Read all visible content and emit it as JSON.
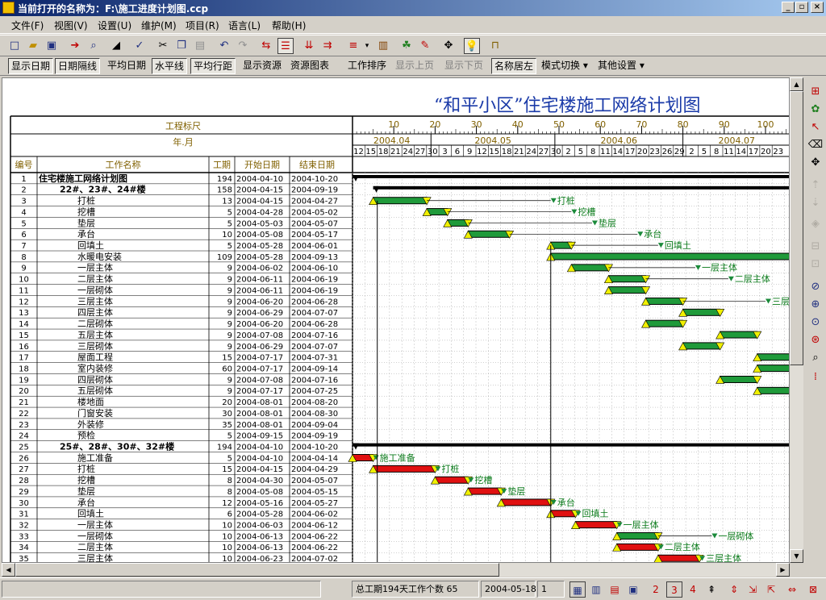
{
  "window": {
    "title": "当前打开的名称为：F:\\施工进度计划图.ccp",
    "min": "_",
    "max": "▫",
    "close": "×"
  },
  "menu": [
    "文件(F)",
    "视图(V)",
    "设置(U)",
    "维护(M)",
    "项目(R)",
    "语言(L)",
    "帮助(H)"
  ],
  "toolbar2": [
    {
      "label": "显示日期",
      "state": "pressed"
    },
    {
      "label": "日期隔线",
      "state": "pressed"
    },
    {
      "label": "平均日期",
      "state": "normal"
    },
    {
      "label": "水平线",
      "state": "pressed"
    },
    {
      "label": "平均行距",
      "state": "pressed"
    },
    {
      "label": "显示资源",
      "state": "normal"
    },
    {
      "label": "资源图表",
      "state": "normal"
    },
    {
      "label": "工作排序",
      "state": "normal"
    },
    {
      "label": "显示上页",
      "state": "disabled"
    },
    {
      "label": "显示下页",
      "state": "disabled"
    },
    {
      "label": "名称居左",
      "state": "pressed"
    },
    {
      "label": "模式切换 ▾",
      "state": "normal"
    },
    {
      "label": "其他设置 ▾",
      "state": "normal"
    }
  ],
  "chart_title": "“和平小区”住宅楼施工网络计划图",
  "header": {
    "ruler_label": "工程标尺",
    "month_label": "年.月",
    "col_id": "编号",
    "col_name": "工作名称",
    "col_dur": "工期",
    "col_start": "开始日期",
    "col_end": "结束日期"
  },
  "ruler_ticks": [
    "10",
    "20",
    "30",
    "40",
    "50",
    "60",
    "70",
    "80",
    "90",
    "100"
  ],
  "months": [
    "2004.04",
    "2004.05",
    "2004.06",
    "2004.07"
  ],
  "days": [
    "12",
    "15",
    "18",
    "21",
    "24",
    "27",
    "30",
    "3",
    "6",
    "9",
    "12",
    "15",
    "18",
    "21",
    "24",
    "27",
    "30",
    "2",
    "5",
    "8",
    "11",
    "14",
    "17",
    "20",
    "23",
    "26",
    "29",
    "2",
    "5",
    "8",
    "11",
    "14",
    "17",
    "20",
    "23"
  ],
  "rows": [
    {
      "id": "1",
      "name": "住宅楼施工网络计划图",
      "dur": "194",
      "start": "2004-04-10",
      "end": "2004-10-20",
      "lvl": 0
    },
    {
      "id": "2",
      "name": "22#、23#、24#楼",
      "dur": "158",
      "start": "2004-04-15",
      "end": "2004-09-19",
      "lvl": 1
    },
    {
      "id": "3",
      "name": "打桩",
      "dur": "13",
      "start": "2004-04-15",
      "end": "2004-04-27",
      "lvl": 2
    },
    {
      "id": "4",
      "name": "挖槽",
      "dur": "5",
      "start": "2004-04-28",
      "end": "2004-05-02",
      "lvl": 2
    },
    {
      "id": "5",
      "name": "垫层",
      "dur": "5",
      "start": "2004-05-03",
      "end": "2004-05-07",
      "lvl": 2
    },
    {
      "id": "6",
      "name": "承台",
      "dur": "10",
      "start": "2004-05-08",
      "end": "2004-05-17",
      "lvl": 2
    },
    {
      "id": "7",
      "name": "回填土",
      "dur": "5",
      "start": "2004-05-28",
      "end": "2004-06-01",
      "lvl": 2
    },
    {
      "id": "8",
      "name": "水暖电安装",
      "dur": "109",
      "start": "2004-05-28",
      "end": "2004-09-13",
      "lvl": 2
    },
    {
      "id": "9",
      "name": "一层主体",
      "dur": "9",
      "start": "2004-06-02",
      "end": "2004-06-10",
      "lvl": 2
    },
    {
      "id": "10",
      "name": "二层主体",
      "dur": "9",
      "start": "2004-06-11",
      "end": "2004-06-19",
      "lvl": 2
    },
    {
      "id": "11",
      "name": "一层砌体",
      "dur": "9",
      "start": "2004-06-11",
      "end": "2004-06-19",
      "lvl": 2
    },
    {
      "id": "12",
      "name": "三层主体",
      "dur": "9",
      "start": "2004-06-20",
      "end": "2004-06-28",
      "lvl": 2
    },
    {
      "id": "13",
      "name": "四层主体",
      "dur": "9",
      "start": "2004-06-29",
      "end": "2004-07-07",
      "lvl": 2
    },
    {
      "id": "14",
      "name": "二层砌体",
      "dur": "9",
      "start": "2004-06-20",
      "end": "2004-06-28",
      "lvl": 2
    },
    {
      "id": "15",
      "name": "五层主体",
      "dur": "9",
      "start": "2004-07-08",
      "end": "2004-07-16",
      "lvl": 2
    },
    {
      "id": "16",
      "name": "三层砌体",
      "dur": "9",
      "start": "2004-06-29",
      "end": "2004-07-07",
      "lvl": 2
    },
    {
      "id": "17",
      "name": "屋面工程",
      "dur": "15",
      "start": "2004-07-17",
      "end": "2004-07-31",
      "lvl": 2
    },
    {
      "id": "18",
      "name": "室内装修",
      "dur": "60",
      "start": "2004-07-17",
      "end": "2004-09-14",
      "lvl": 2
    },
    {
      "id": "19",
      "name": "四层砌体",
      "dur": "9",
      "start": "2004-07-08",
      "end": "2004-07-16",
      "lvl": 2
    },
    {
      "id": "20",
      "name": "五层砌体",
      "dur": "9",
      "start": "2004-07-17",
      "end": "2004-07-25",
      "lvl": 2
    },
    {
      "id": "21",
      "name": "楼地面",
      "dur": "20",
      "start": "2004-08-01",
      "end": "2004-08-20",
      "lvl": 2
    },
    {
      "id": "22",
      "name": "门窗安装",
      "dur": "30",
      "start": "2004-08-01",
      "end": "2004-08-30",
      "lvl": 2
    },
    {
      "id": "23",
      "name": "外装修",
      "dur": "35",
      "start": "2004-08-01",
      "end": "2004-09-04",
      "lvl": 2
    },
    {
      "id": "24",
      "name": "预检",
      "dur": "5",
      "start": "2004-09-15",
      "end": "2004-09-19",
      "lvl": 2
    },
    {
      "id": "25",
      "name": "25#、28#、30#、32#楼",
      "dur": "194",
      "start": "2004-04-10",
      "end": "2004-10-20",
      "lvl": 1
    },
    {
      "id": "26",
      "name": "施工准备",
      "dur": "5",
      "start": "2004-04-10",
      "end": "2004-04-14",
      "lvl": 2
    },
    {
      "id": "27",
      "name": "打桩",
      "dur": "15",
      "start": "2004-04-15",
      "end": "2004-04-29",
      "lvl": 2
    },
    {
      "id": "28",
      "name": "挖槽",
      "dur": "8",
      "start": "2004-04-30",
      "end": "2004-05-07",
      "lvl": 2
    },
    {
      "id": "29",
      "name": "垫层",
      "dur": "8",
      "start": "2004-05-08",
      "end": "2004-05-15",
      "lvl": 2
    },
    {
      "id": "30",
      "name": "承台",
      "dur": "12",
      "start": "2004-05-16",
      "end": "2004-05-27",
      "lvl": 2
    },
    {
      "id": "31",
      "name": "回填土",
      "dur": "6",
      "start": "2004-05-28",
      "end": "2004-06-02",
      "lvl": 2
    },
    {
      "id": "32",
      "name": "一层主体",
      "dur": "10",
      "start": "2004-06-03",
      "end": "2004-06-12",
      "lvl": 2
    },
    {
      "id": "33",
      "name": "一层砌体",
      "dur": "10",
      "start": "2004-06-13",
      "end": "2004-06-22",
      "lvl": 2
    },
    {
      "id": "34",
      "name": "二层主体",
      "dur": "10",
      "start": "2004-06-13",
      "end": "2004-06-22",
      "lvl": 2
    },
    {
      "id": "35",
      "name": "三层主体",
      "dur": "10",
      "start": "2004-06-23",
      "end": "2004-07-02",
      "lvl": 2
    }
  ],
  "bars": [
    {
      "row": 0,
      "s": 0,
      "e": 200,
      "type": "summary"
    },
    {
      "row": 1,
      "s": 5,
      "e": 200,
      "type": "summary"
    },
    {
      "row": 2,
      "s": 5,
      "e": 18,
      "type": "green",
      "label": "打桩",
      "lbl": 48
    },
    {
      "row": 3,
      "s": 18,
      "e": 23,
      "type": "green",
      "label": "挖槽",
      "lbl": 53
    },
    {
      "row": 4,
      "s": 23,
      "e": 28,
      "type": "green",
      "label": "垫层",
      "lbl": 58
    },
    {
      "row": 5,
      "s": 28,
      "e": 38,
      "type": "green",
      "label": "承台",
      "lbl": 69
    },
    {
      "row": 6,
      "s": 48,
      "e": 53,
      "type": "green",
      "label": "回填土",
      "lbl": 74
    },
    {
      "row": 7,
      "s": 48,
      "e": 200,
      "type": "green"
    },
    {
      "row": 8,
      "s": 53,
      "e": 62,
      "type": "green",
      "label": "一层主体",
      "lbl": 83
    },
    {
      "row": 9,
      "s": 62,
      "e": 71,
      "type": "green",
      "label": "二层主体",
      "lbl": 91
    },
    {
      "row": 10,
      "s": 62,
      "e": 71,
      "type": "green"
    },
    {
      "row": 11,
      "s": 71,
      "e": 80,
      "type": "green",
      "label": "三层主体",
      "lbl": 100
    },
    {
      "row": 12,
      "s": 80,
      "e": 89,
      "type": "green"
    },
    {
      "row": 13,
      "s": 71,
      "e": 80,
      "type": "green"
    },
    {
      "row": 14,
      "s": 89,
      "e": 98,
      "type": "green"
    },
    {
      "row": 15,
      "s": 80,
      "e": 89,
      "type": "green"
    },
    {
      "row": 16,
      "s": 98,
      "e": 200,
      "type": "green"
    },
    {
      "row": 17,
      "s": 98,
      "e": 200,
      "type": "green"
    },
    {
      "row": 18,
      "s": 89,
      "e": 98,
      "type": "green"
    },
    {
      "row": 19,
      "s": 98,
      "e": 200,
      "type": "green"
    },
    {
      "row": 24,
      "s": 0,
      "e": 200,
      "type": "summary"
    },
    {
      "row": 25,
      "s": 0,
      "e": 5,
      "type": "red",
      "label": "施工准备",
      "lbl": 5
    },
    {
      "row": 26,
      "s": 5,
      "e": 20,
      "type": "red",
      "label": "打桩",
      "lbl": 20
    },
    {
      "row": 27,
      "s": 20,
      "e": 28,
      "type": "red",
      "label": "挖槽",
      "lbl": 28
    },
    {
      "row": 28,
      "s": 28,
      "e": 36,
      "type": "red",
      "label": "垫层",
      "lbl": 36
    },
    {
      "row": 29,
      "s": 36,
      "e": 48,
      "type": "red",
      "label": "承台",
      "lbl": 48
    },
    {
      "row": 30,
      "s": 48,
      "e": 54,
      "type": "red",
      "label": "回填土",
      "lbl": 54
    },
    {
      "row": 31,
      "s": 54,
      "e": 64,
      "type": "red",
      "label": "一层主体",
      "lbl": 64
    },
    {
      "row": 32,
      "s": 64,
      "e": 74,
      "type": "green",
      "label": "一层砌体",
      "lbl": 87
    },
    {
      "row": 33,
      "s": 64,
      "e": 74,
      "type": "red",
      "label": "二层主体",
      "lbl": 74
    },
    {
      "row": 34,
      "s": 74,
      "e": 84,
      "type": "red",
      "label": "三层主体",
      "lbl": 84
    }
  ],
  "status": {
    "summary": "总工期194天工作个数 65",
    "date": "2004-05-18",
    "page": "1"
  },
  "colors": {
    "green": "#1f9a3a",
    "red": "#e01010",
    "milestone": "#f0f000",
    "label": "#0a7a1a",
    "title": "#1a3aa8"
  }
}
